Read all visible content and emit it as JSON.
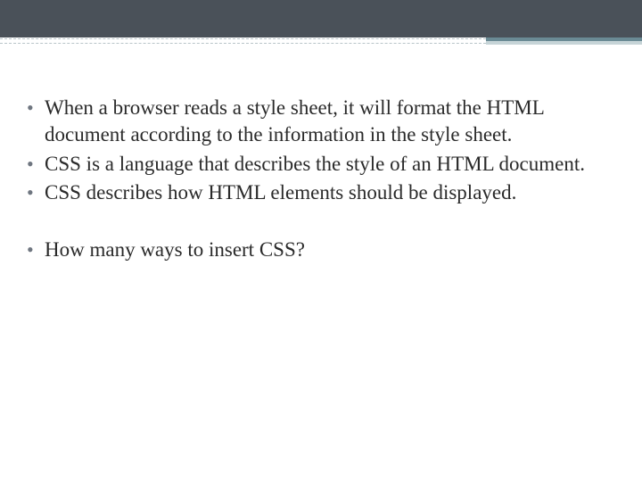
{
  "bullets": [
    "When a browser reads a style sheet, it will format the HTML document according to the information in the style sheet.",
    "CSS is a language that describes the style of an HTML document.",
    "CSS describes how HTML elements should be displayed.",
    "How many ways to insert CSS?"
  ]
}
